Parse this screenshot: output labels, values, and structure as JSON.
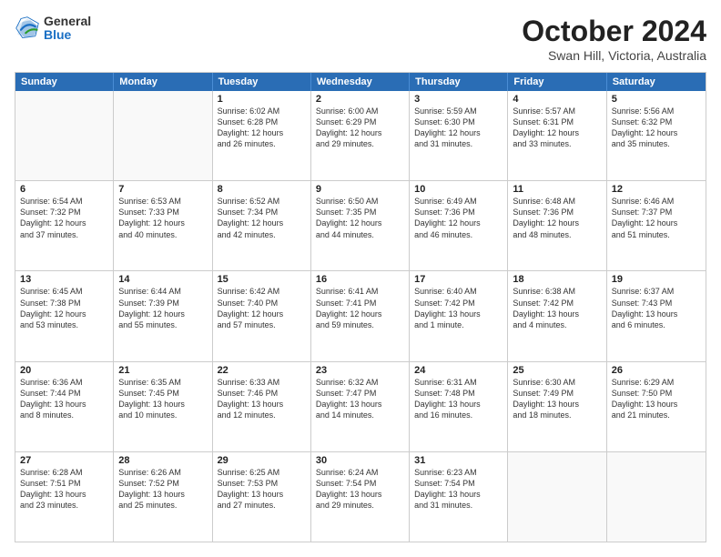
{
  "header": {
    "logo": {
      "general": "General",
      "blue": "Blue"
    },
    "title": "October 2024",
    "subtitle": "Swan Hill, Victoria, Australia"
  },
  "calendar": {
    "days": [
      "Sunday",
      "Monday",
      "Tuesday",
      "Wednesday",
      "Thursday",
      "Friday",
      "Saturday"
    ],
    "rows": [
      [
        {
          "day": "",
          "content": ""
        },
        {
          "day": "",
          "content": ""
        },
        {
          "day": "1",
          "content": "Sunrise: 6:02 AM\nSunset: 6:28 PM\nDaylight: 12 hours\nand 26 minutes."
        },
        {
          "day": "2",
          "content": "Sunrise: 6:00 AM\nSunset: 6:29 PM\nDaylight: 12 hours\nand 29 minutes."
        },
        {
          "day": "3",
          "content": "Sunrise: 5:59 AM\nSunset: 6:30 PM\nDaylight: 12 hours\nand 31 minutes."
        },
        {
          "day": "4",
          "content": "Sunrise: 5:57 AM\nSunset: 6:31 PM\nDaylight: 12 hours\nand 33 minutes."
        },
        {
          "day": "5",
          "content": "Sunrise: 5:56 AM\nSunset: 6:32 PM\nDaylight: 12 hours\nand 35 minutes."
        }
      ],
      [
        {
          "day": "6",
          "content": "Sunrise: 6:54 AM\nSunset: 7:32 PM\nDaylight: 12 hours\nand 37 minutes."
        },
        {
          "day": "7",
          "content": "Sunrise: 6:53 AM\nSunset: 7:33 PM\nDaylight: 12 hours\nand 40 minutes."
        },
        {
          "day": "8",
          "content": "Sunrise: 6:52 AM\nSunset: 7:34 PM\nDaylight: 12 hours\nand 42 minutes."
        },
        {
          "day": "9",
          "content": "Sunrise: 6:50 AM\nSunset: 7:35 PM\nDaylight: 12 hours\nand 44 minutes."
        },
        {
          "day": "10",
          "content": "Sunrise: 6:49 AM\nSunset: 7:36 PM\nDaylight: 12 hours\nand 46 minutes."
        },
        {
          "day": "11",
          "content": "Sunrise: 6:48 AM\nSunset: 7:36 PM\nDaylight: 12 hours\nand 48 minutes."
        },
        {
          "day": "12",
          "content": "Sunrise: 6:46 AM\nSunset: 7:37 PM\nDaylight: 12 hours\nand 51 minutes."
        }
      ],
      [
        {
          "day": "13",
          "content": "Sunrise: 6:45 AM\nSunset: 7:38 PM\nDaylight: 12 hours\nand 53 minutes."
        },
        {
          "day": "14",
          "content": "Sunrise: 6:44 AM\nSunset: 7:39 PM\nDaylight: 12 hours\nand 55 minutes."
        },
        {
          "day": "15",
          "content": "Sunrise: 6:42 AM\nSunset: 7:40 PM\nDaylight: 12 hours\nand 57 minutes."
        },
        {
          "day": "16",
          "content": "Sunrise: 6:41 AM\nSunset: 7:41 PM\nDaylight: 12 hours\nand 59 minutes."
        },
        {
          "day": "17",
          "content": "Sunrise: 6:40 AM\nSunset: 7:42 PM\nDaylight: 13 hours\nand 1 minute."
        },
        {
          "day": "18",
          "content": "Sunrise: 6:38 AM\nSunset: 7:42 PM\nDaylight: 13 hours\nand 4 minutes."
        },
        {
          "day": "19",
          "content": "Sunrise: 6:37 AM\nSunset: 7:43 PM\nDaylight: 13 hours\nand 6 minutes."
        }
      ],
      [
        {
          "day": "20",
          "content": "Sunrise: 6:36 AM\nSunset: 7:44 PM\nDaylight: 13 hours\nand 8 minutes."
        },
        {
          "day": "21",
          "content": "Sunrise: 6:35 AM\nSunset: 7:45 PM\nDaylight: 13 hours\nand 10 minutes."
        },
        {
          "day": "22",
          "content": "Sunrise: 6:33 AM\nSunset: 7:46 PM\nDaylight: 13 hours\nand 12 minutes."
        },
        {
          "day": "23",
          "content": "Sunrise: 6:32 AM\nSunset: 7:47 PM\nDaylight: 13 hours\nand 14 minutes."
        },
        {
          "day": "24",
          "content": "Sunrise: 6:31 AM\nSunset: 7:48 PM\nDaylight: 13 hours\nand 16 minutes."
        },
        {
          "day": "25",
          "content": "Sunrise: 6:30 AM\nSunset: 7:49 PM\nDaylight: 13 hours\nand 18 minutes."
        },
        {
          "day": "26",
          "content": "Sunrise: 6:29 AM\nSunset: 7:50 PM\nDaylight: 13 hours\nand 21 minutes."
        }
      ],
      [
        {
          "day": "27",
          "content": "Sunrise: 6:28 AM\nSunset: 7:51 PM\nDaylight: 13 hours\nand 23 minutes."
        },
        {
          "day": "28",
          "content": "Sunrise: 6:26 AM\nSunset: 7:52 PM\nDaylight: 13 hours\nand 25 minutes."
        },
        {
          "day": "29",
          "content": "Sunrise: 6:25 AM\nSunset: 7:53 PM\nDaylight: 13 hours\nand 27 minutes."
        },
        {
          "day": "30",
          "content": "Sunrise: 6:24 AM\nSunset: 7:54 PM\nDaylight: 13 hours\nand 29 minutes."
        },
        {
          "day": "31",
          "content": "Sunrise: 6:23 AM\nSunset: 7:54 PM\nDaylight: 13 hours\nand 31 minutes."
        },
        {
          "day": "",
          "content": ""
        },
        {
          "day": "",
          "content": ""
        }
      ]
    ]
  }
}
